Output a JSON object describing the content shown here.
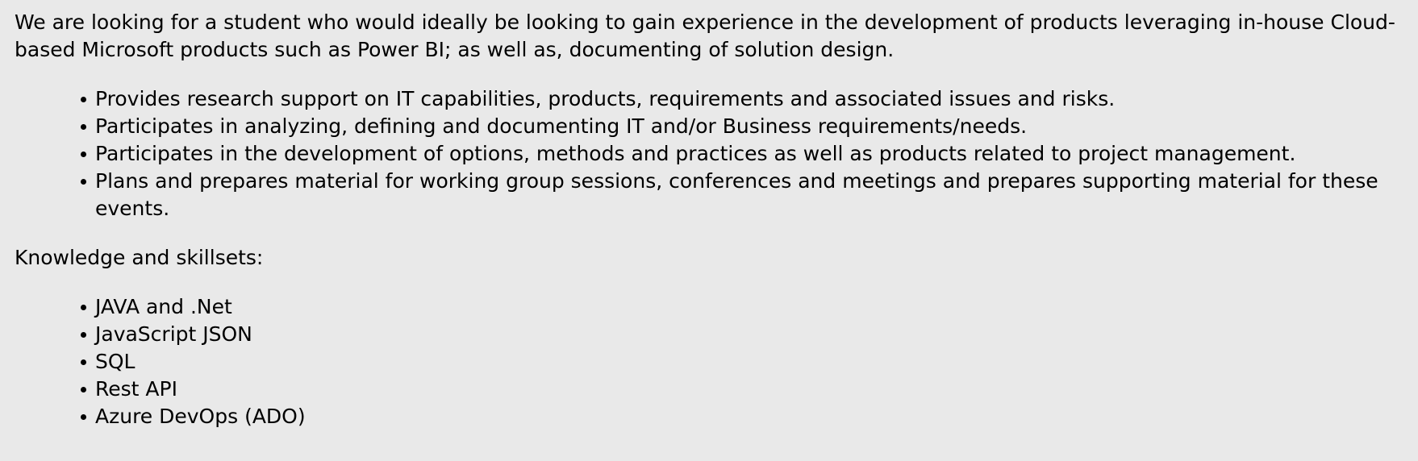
{
  "intro": "We are looking for a student who would ideally be looking to gain experience in the development of products leveraging in-house Cloud-based Microsoft products such as Power BI; as well as, documenting of solution design.",
  "duties": [
    "Provides research support on IT capabilities, products, requirements and associated issues and risks.",
    "Participates in analyzing, defining and documenting IT and/or Business requirements/needs.",
    "Participates in the development of options, methods and practices as well as products related to project management.",
    "Plans and prepares material for working group sessions, conferences and meetings and prepares supporting material for these events."
  ],
  "skills_heading": "Knowledge and skillsets:",
  "skills": [
    "JAVA and .Net",
    "JavaScript JSON",
    "SQL",
    "Rest API",
    "Azure DevOps (ADO)"
  ]
}
